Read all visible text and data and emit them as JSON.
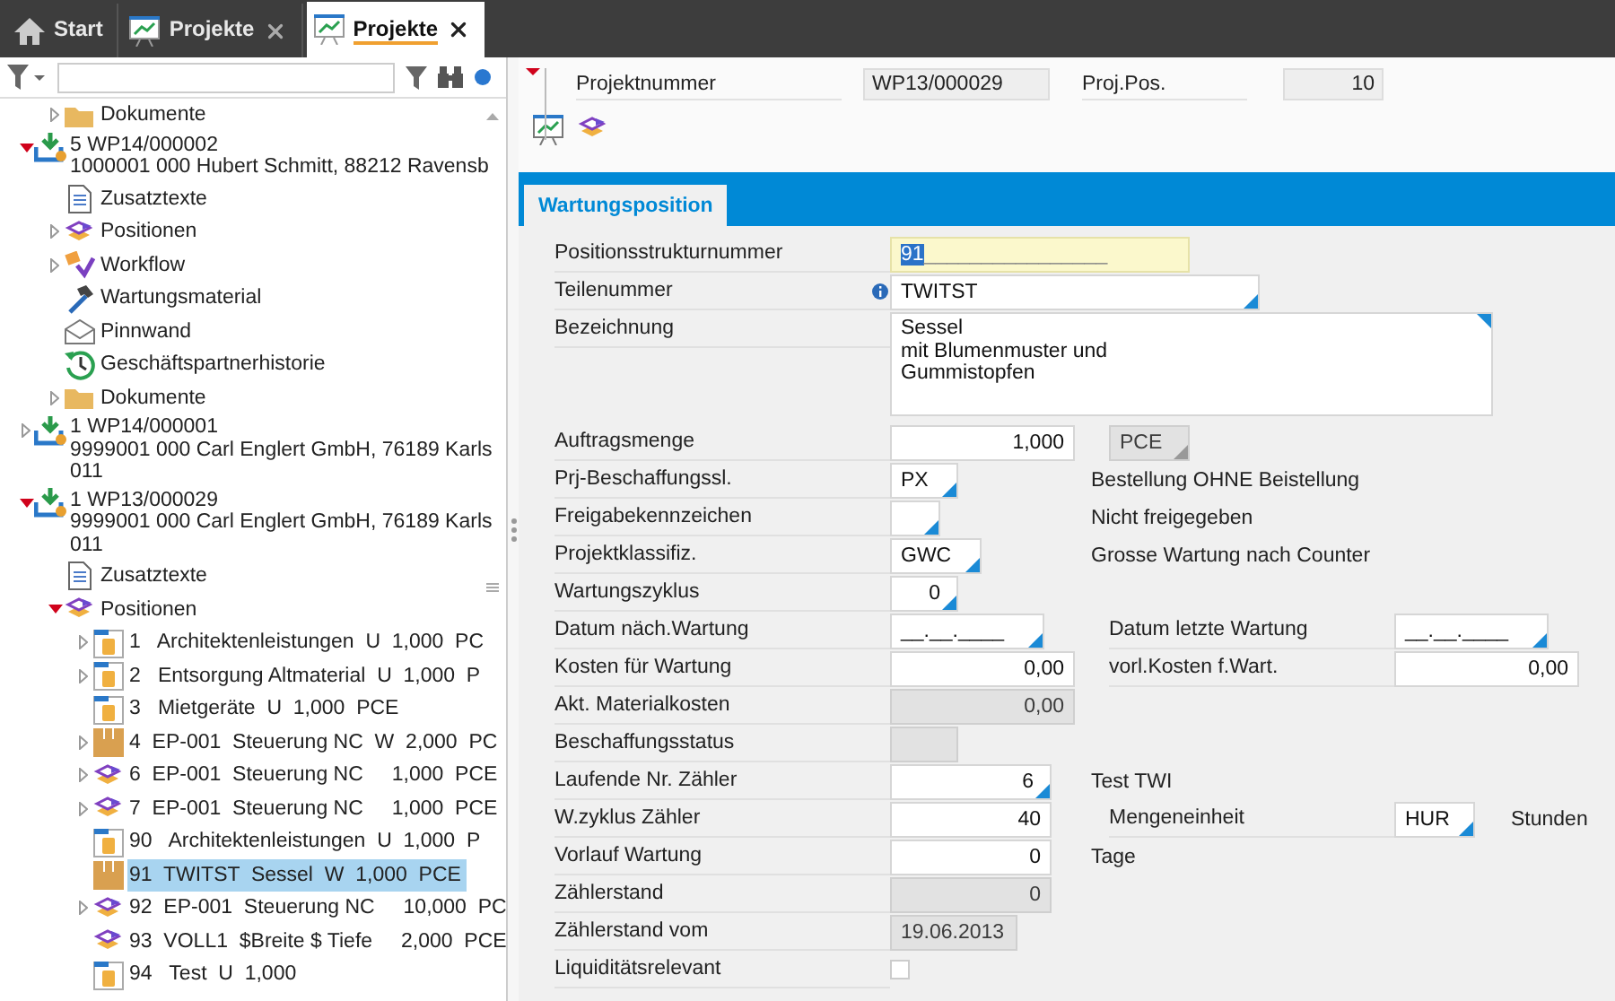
{
  "tabs": [
    {
      "label": "Start",
      "kind": "home",
      "closable": false,
      "selected": false
    },
    {
      "label": "Projekte",
      "kind": "chart",
      "closable": true,
      "selected": false
    },
    {
      "label": "Projekte",
      "kind": "chart",
      "closable": true,
      "selected": true
    }
  ],
  "tree": {
    "continued_children": [
      {
        "lines": [
          "Dokumente"
        ],
        "kind": "folder",
        "expandable": true,
        "expanded": false,
        "selected": false
      }
    ],
    "items": [
      {
        "lines": [
          "5 WP14/000002",
          "1000001 000 Hubert Schmitt, 88212 Ravensb"
        ],
        "kind": "project",
        "expandable": true,
        "expanded": true,
        "selected": false,
        "children": [
          {
            "lines": [
              "Zusatztexte"
            ],
            "kind": "document",
            "expandable": false,
            "selected": false
          },
          {
            "lines": [
              "Positionen"
            ],
            "kind": "positions",
            "expandable": true,
            "expanded": false,
            "selected": false
          },
          {
            "lines": [
              "Workflow"
            ],
            "kind": "workflow",
            "expandable": true,
            "expanded": false,
            "selected": false
          },
          {
            "lines": [
              "Wartungsmaterial"
            ],
            "kind": "tool",
            "expandable": false,
            "selected": false
          },
          {
            "lines": [
              "Pinnwand"
            ],
            "kind": "mail",
            "expandable": false,
            "selected": false
          },
          {
            "lines": [
              "Geschäftspartnerhistorie"
            ],
            "kind": "history",
            "expandable": false,
            "selected": false
          },
          {
            "lines": [
              "Dokumente"
            ],
            "kind": "folder",
            "expandable": true,
            "expanded": false,
            "selected": false
          }
        ]
      },
      {
        "lines": [
          "1 WP14/000001",
          "9999001 000 Carl Englert GmbH, 76189 Karls",
          "011"
        ],
        "kind": "project",
        "expandable": true,
        "expanded": false,
        "selected": false
      },
      {
        "lines": [
          "1 WP13/000029",
          "9999001 000 Carl Englert GmbH, 76189 Karls",
          "011"
        ],
        "kind": "project",
        "expandable": true,
        "expanded": true,
        "selected": false,
        "children": [
          {
            "lines": [
              "Zusatztexte"
            ],
            "kind": "document",
            "expandable": false,
            "selected": false
          },
          {
            "lines": [
              "Positionen"
            ],
            "kind": "positions",
            "expandable": true,
            "expanded": true,
            "selected": false,
            "children": [
              {
                "lines": [
                  "1   Architektenleistungen  U  1,000  PC"
                ],
                "kind": "service",
                "expandable": true,
                "expanded": false,
                "selected": false
              },
              {
                "lines": [
                  "2   Entsorgung Altmaterial  U  1,000  P"
                ],
                "kind": "service",
                "expandable": true,
                "expanded": false,
                "selected": false
              },
              {
                "lines": [
                  "3   Mietgeräte  U  1,000  PCE"
                ],
                "kind": "service",
                "expandable": false,
                "selected": false
              },
              {
                "lines": [
                  "4  EP-001  Steuerung NC  W  2,000  PC"
                ],
                "kind": "material",
                "expandable": true,
                "expanded": false,
                "selected": false
              },
              {
                "lines": [
                  "6  EP-001  Steuerung NC     1,000  PCE"
                ],
                "kind": "assembly",
                "expandable": true,
                "expanded": false,
                "selected": false
              },
              {
                "lines": [
                  "7  EP-001  Steuerung NC     1,000  PCE"
                ],
                "kind": "assembly",
                "expandable": true,
                "expanded": false,
                "selected": false
              },
              {
                "lines": [
                  "90   Architektenleistungen  U  1,000  P"
                ],
                "kind": "service",
                "expandable": false,
                "selected": false
              },
              {
                "lines": [
                  "91  TWITST  Sessel  W  1,000  PCE"
                ],
                "kind": "material",
                "expandable": false,
                "selected": true
              },
              {
                "lines": [
                  "92  EP-001  Steuerung NC     10,000  PC"
                ],
                "kind": "assembly",
                "expandable": true,
                "expanded": false,
                "selected": false
              },
              {
                "lines": [
                  "93  VOLL1  $Breite $ Tiefe     2,000  PCE"
                ],
                "kind": "assembly",
                "expandable": false,
                "selected": false
              },
              {
                "lines": [
                  "94   Test  U  1,000"
                ],
                "kind": "service",
                "expandable": false,
                "selected": false
              }
            ]
          }
        ]
      }
    ]
  },
  "header": {
    "fields": [
      {
        "label": "Projektnummer",
        "value": "WP13/000029"
      },
      {
        "label": "Proj.Pos.",
        "value": "10"
      }
    ]
  },
  "section_tab": {
    "label": "Wartungsposition",
    "selected": true
  },
  "form": {
    "rows": [
      {
        "label": "Positionsstrukturnummer",
        "info": false,
        "field": {
          "kind": "mask",
          "value": "91",
          "mask": "________________",
          "combo": false,
          "readonly": false
        }
      },
      {
        "label": "Teilenummer",
        "info": true,
        "field": {
          "kind": "lookup",
          "value": "TWITST",
          "combo": true,
          "readonly": false
        }
      },
      {
        "label": "Bezeichnung",
        "info": false,
        "field": {
          "kind": "textarea",
          "value": "Sessel\nmit Blumenmuster und\nGummistopfen",
          "combo": true,
          "readonly": false
        }
      },
      {
        "label": "Auftragsmenge",
        "info": false,
        "field": {
          "kind": "amount",
          "value": "1,000",
          "combo": false,
          "readonly": false
        },
        "side": {
          "kind": "unit",
          "field": {
            "kind": "unit",
            "value": "PCE",
            "combo": true,
            "readonly": true
          }
        }
      },
      {
        "label": "Prj-Beschaffungssl.",
        "info": false,
        "field": {
          "kind": "code",
          "value": "PX",
          "combo": true,
          "readonly": false
        },
        "side": {
          "kind": "note",
          "text": "Bestellung OHNE Beistellung"
        }
      },
      {
        "label": "Freigabekennzeichen",
        "info": false,
        "field": {
          "kind": "code",
          "combo": true,
          "readonly": false
        },
        "side": {
          "kind": "note",
          "text": "Nicht freigegeben"
        }
      },
      {
        "label": "Projektklassifiz.",
        "info": false,
        "field": {
          "kind": "code",
          "value": "GWC",
          "combo": true,
          "readonly": false
        },
        "side": {
          "kind": "note",
          "text": "Grosse Wartung nach Counter"
        }
      },
      {
        "label": "Wartungszyklus",
        "info": false,
        "field": {
          "kind": "number-code",
          "value": "0",
          "combo": true,
          "readonly": false
        }
      },
      {
        "label": "Datum näch.Wartung",
        "info": false,
        "field": {
          "kind": "date",
          "value": "__.__.____",
          "combo": true,
          "readonly": false
        },
        "side": {
          "kind": "labeled",
          "label": "Datum letzte Wartung",
          "field": {
            "kind": "date",
            "value": "__.__.____",
            "combo": true,
            "readonly": false
          }
        }
      },
      {
        "label": "Kosten für Wartung",
        "info": false,
        "field": {
          "kind": "amount",
          "value": "0,00",
          "combo": false,
          "readonly": false
        },
        "side": {
          "kind": "labeled",
          "label": "vorl.Kosten f.Wart.",
          "field": {
            "kind": "amount",
            "value": "0,00",
            "combo": false,
            "readonly": false
          }
        }
      },
      {
        "label": "Akt. Materialkosten",
        "info": false,
        "field": {
          "kind": "amount",
          "value": "0,00",
          "combo": false,
          "readonly": true
        }
      },
      {
        "label": "Beschaffungsstatus",
        "info": false,
        "field": {
          "kind": "status",
          "combo": false,
          "readonly": true
        }
      },
      {
        "label": "Laufende Nr. Zähler",
        "info": false,
        "field": {
          "kind": "counter",
          "value": "6",
          "combo": true,
          "readonly": false
        },
        "side": {
          "kind": "note",
          "text": "Test TWI"
        }
      },
      {
        "label": "W.zyklus Zähler",
        "info": false,
        "field": {
          "kind": "counter",
          "value": "40",
          "combo": false,
          "readonly": false
        },
        "side": {
          "kind": "labeled",
          "label": "Mengeneinheit",
          "field": {
            "kind": "unit",
            "value": "HUR",
            "combo": true,
            "readonly": false
          },
          "note": "Stunden"
        }
      },
      {
        "label": "Vorlauf Wartung",
        "info": false,
        "field": {
          "kind": "counter",
          "value": "0",
          "combo": false,
          "readonly": false
        },
        "side": {
          "kind": "note",
          "text": "Tage"
        }
      },
      {
        "label": "Zählerstand",
        "info": false,
        "field": {
          "kind": "counter",
          "value": "0",
          "combo": false,
          "readonly": true
        }
      },
      {
        "label": "Zählerstand vom",
        "info": false,
        "field": {
          "kind": "stamp",
          "value": "19.06.2013",
          "combo": false,
          "readonly": true
        }
      },
      {
        "label": "Liquiditätsrelevant",
        "info": false,
        "field": {
          "kind": "checkbox",
          "checked": false
        }
      }
    ]
  }
}
